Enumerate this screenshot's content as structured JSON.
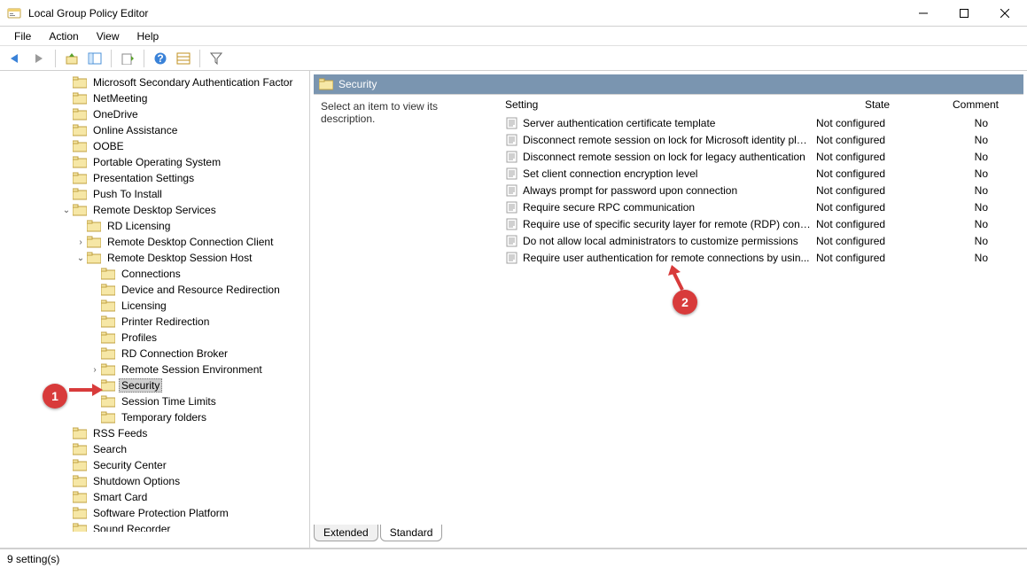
{
  "window": {
    "title": "Local Group Policy Editor"
  },
  "menu": {
    "file": "File",
    "action": "Action",
    "view": "View",
    "help": "Help"
  },
  "tree": {
    "items": [
      {
        "indent": 4,
        "exp": "",
        "label": "Microsoft Secondary Authentication Factor"
      },
      {
        "indent": 4,
        "exp": "",
        "label": "NetMeeting"
      },
      {
        "indent": 4,
        "exp": "",
        "label": "OneDrive"
      },
      {
        "indent": 4,
        "exp": "",
        "label": "Online Assistance"
      },
      {
        "indent": 4,
        "exp": "",
        "label": "OOBE"
      },
      {
        "indent": 4,
        "exp": "",
        "label": "Portable Operating System"
      },
      {
        "indent": 4,
        "exp": "",
        "label": "Presentation Settings"
      },
      {
        "indent": 4,
        "exp": "",
        "label": "Push To Install"
      },
      {
        "indent": 4,
        "exp": "v",
        "label": "Remote Desktop Services"
      },
      {
        "indent": 5,
        "exp": "",
        "label": "RD Licensing"
      },
      {
        "indent": 5,
        "exp": ">",
        "label": "Remote Desktop Connection Client"
      },
      {
        "indent": 5,
        "exp": "v",
        "label": "Remote Desktop Session Host"
      },
      {
        "indent": 6,
        "exp": "",
        "label": "Connections"
      },
      {
        "indent": 6,
        "exp": "",
        "label": "Device and Resource Redirection"
      },
      {
        "indent": 6,
        "exp": "",
        "label": "Licensing"
      },
      {
        "indent": 6,
        "exp": "",
        "label": "Printer Redirection"
      },
      {
        "indent": 6,
        "exp": "",
        "label": "Profiles"
      },
      {
        "indent": 6,
        "exp": "",
        "label": "RD Connection Broker"
      },
      {
        "indent": 6,
        "exp": ">",
        "label": "Remote Session Environment"
      },
      {
        "indent": 6,
        "exp": "",
        "label": "Security",
        "selected": true
      },
      {
        "indent": 6,
        "exp": "",
        "label": "Session Time Limits"
      },
      {
        "indent": 6,
        "exp": "",
        "label": "Temporary folders"
      },
      {
        "indent": 4,
        "exp": "",
        "label": "RSS Feeds"
      },
      {
        "indent": 4,
        "exp": "",
        "label": "Search"
      },
      {
        "indent": 4,
        "exp": "",
        "label": "Security Center"
      },
      {
        "indent": 4,
        "exp": "",
        "label": "Shutdown Options"
      },
      {
        "indent": 4,
        "exp": "",
        "label": "Smart Card"
      },
      {
        "indent": 4,
        "exp": "",
        "label": "Software Protection Platform"
      },
      {
        "indent": 4,
        "exp": "",
        "label": "Sound Recorder"
      }
    ]
  },
  "right": {
    "header_label": "Security",
    "description_prompt": "Select an item to view its description.",
    "columns": {
      "setting": "Setting",
      "state": "State",
      "comment": "Comment"
    },
    "settings": [
      {
        "name": "Server authentication certificate template",
        "state": "Not configured",
        "comment": "No"
      },
      {
        "name": "Disconnect remote session on lock for Microsoft identity pla...",
        "state": "Not configured",
        "comment": "No"
      },
      {
        "name": "Disconnect remote session on lock for legacy authentication",
        "state": "Not configured",
        "comment": "No"
      },
      {
        "name": "Set client connection encryption level",
        "state": "Not configured",
        "comment": "No"
      },
      {
        "name": "Always prompt for password upon connection",
        "state": "Not configured",
        "comment": "No"
      },
      {
        "name": "Require secure RPC communication",
        "state": "Not configured",
        "comment": "No"
      },
      {
        "name": "Require use of specific security layer for remote (RDP) conn...",
        "state": "Not configured",
        "comment": "No"
      },
      {
        "name": "Do not allow local administrators to customize permissions",
        "state": "Not configured",
        "comment": "No"
      },
      {
        "name": "Require user authentication for remote connections by usin...",
        "state": "Not configured",
        "comment": "No"
      }
    ]
  },
  "tabs": {
    "extended": "Extended",
    "standard": "Standard"
  },
  "status": {
    "text": "9 setting(s)"
  },
  "callouts": {
    "one": "1",
    "two": "2"
  }
}
